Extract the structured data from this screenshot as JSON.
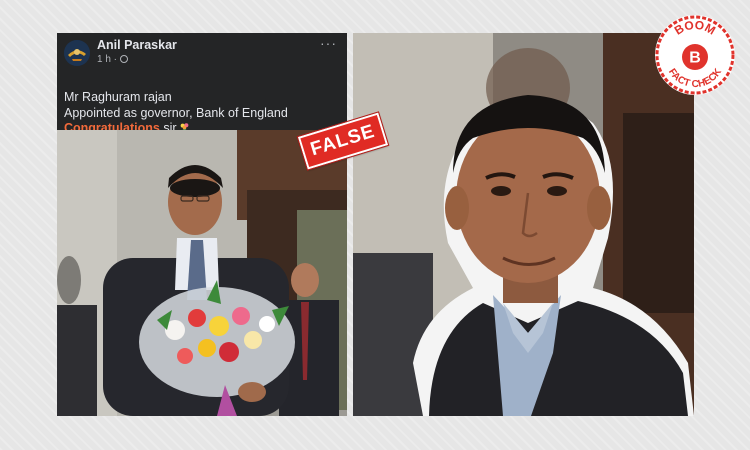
{
  "post": {
    "author": "Anil Paraskar",
    "time": "1 h",
    "more": "···",
    "line1": "Mr Raghuram rajan",
    "line2": "Appointed as governor, Bank of England",
    "congrats": "Congratulations",
    "sir": " sir"
  },
  "stamp": {
    "label": "FALSE"
  },
  "logo": {
    "top_text": "BOOM",
    "letter": "B",
    "bottom_text": "FACT CHECK",
    "red": "#e0332c"
  },
  "icons": {
    "globe": "globe-icon",
    "more": "more-options-icon",
    "bouquet": "bouquet-emoji-icon"
  }
}
